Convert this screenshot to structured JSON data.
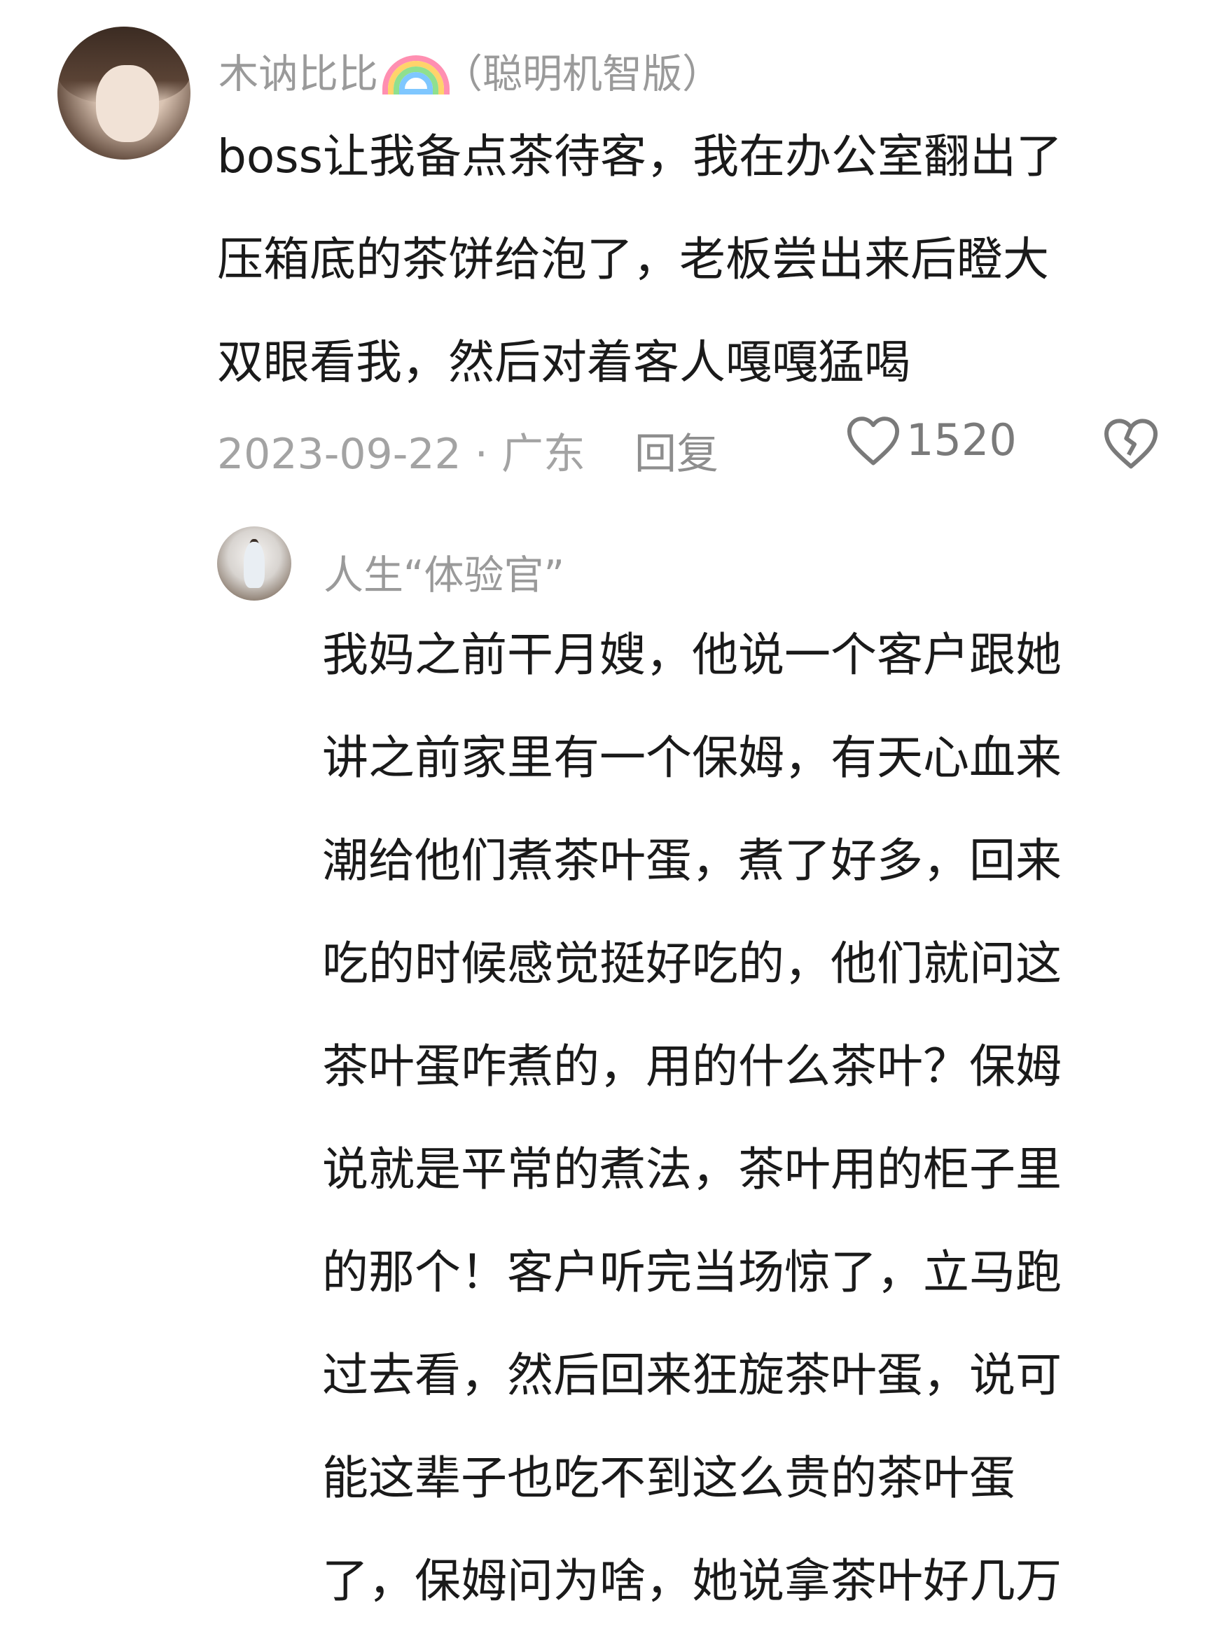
{
  "comment": {
    "username": "木讷比比",
    "username_suffix": "（聪明机智版）",
    "lines": [
      "boss让我备点茶待客，我在办公室翻出了",
      "压箱底的茶饼给泡了，老板尝出来后瞪大",
      "双眼看我，然后对着客人嘎嘎猛喝"
    ],
    "date_location": "2023-09-22 · 广东",
    "reply_label": "回复",
    "like_count": "1520",
    "like_icon": "heart-outline-icon",
    "dislike_icon": "broken-heart-icon"
  },
  "reply": {
    "username": "人生“体验官”",
    "lines": [
      "我妈之前干月嫂，他说一个客户跟她",
      "讲之前家里有一个保姆，有天心血来",
      "潮给他们煮茶叶蛋，煮了好多，回来",
      "吃的时候感觉挺好吃的，他们就问这",
      "茶叶蛋咋煮的，用的什么茶叶？保姆",
      "说就是平常的煮法，茶叶用的柜子里",
      "的那个！客户听完当场惊了，立马跑",
      "过去看，然后回来狂旋茶叶蛋，说可",
      "能这辈子也吃不到这么贵的茶叶蛋",
      "了，保姆问为啥，她说拿茶叶好几万"
    ]
  }
}
